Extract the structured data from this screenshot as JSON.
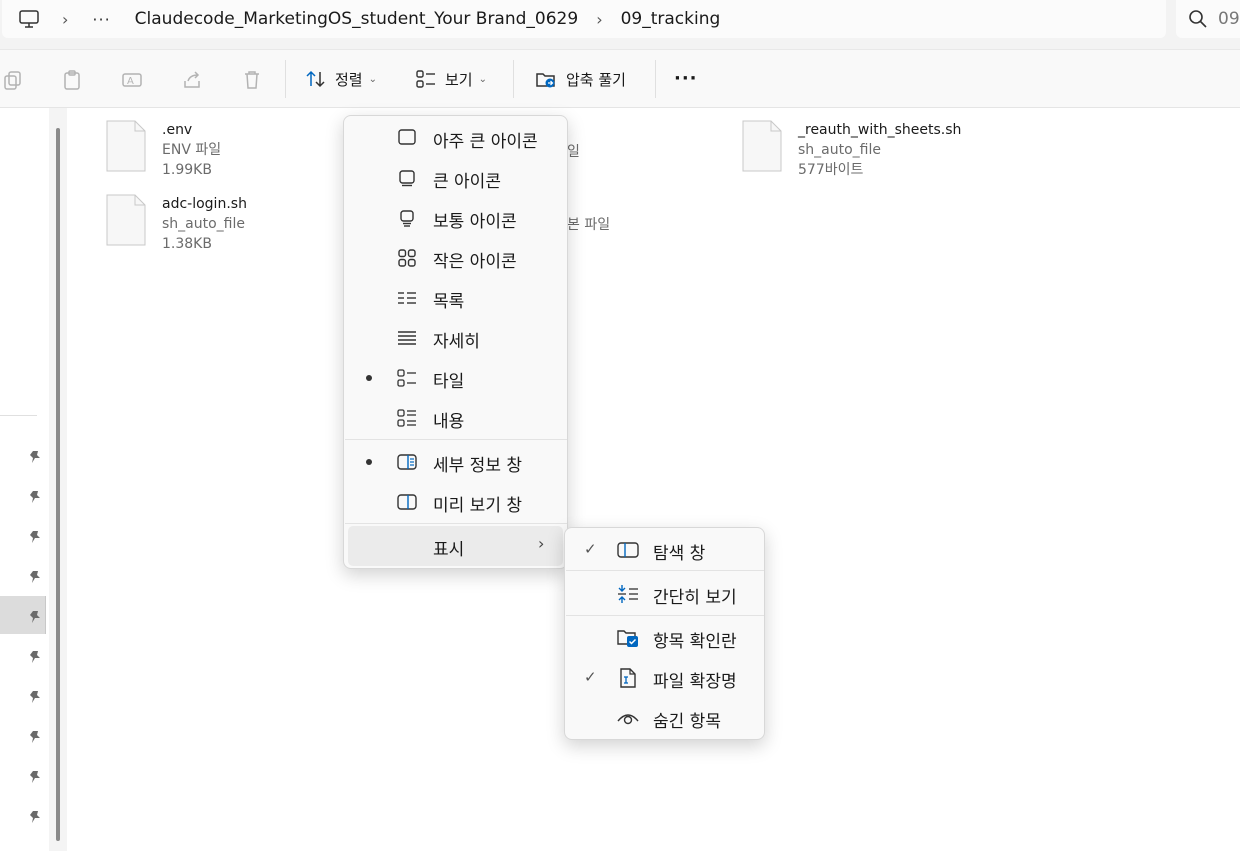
{
  "address_bar": {
    "computer_icon": "monitor-icon",
    "ellipsis": "···",
    "path": [
      "Claudecode_MarketingOS_student_Your Brand_0629",
      "09_tracking"
    ],
    "search_placeholder": "09"
  },
  "toolbar": {
    "sort_label": "정렬",
    "view_label": "보기",
    "extract_label": "압축 풀기",
    "more_label": "···"
  },
  "files": [
    {
      "name": ".env",
      "type": "ENV 파일",
      "size": "1.99KB"
    },
    {
      "name": "adc-login.sh",
      "type": "sh_auto_file",
      "size": "1.38KB"
    },
    {
      "name": "_reauth_with_sheets.sh",
      "type": "sh_auto_file",
      "size": "577바이트"
    }
  ],
  "obscured_text": [
    "일",
    "본 파일"
  ],
  "view_menu": {
    "layout_items": [
      {
        "label": "아주 큰 아이콘",
        "icon": "extra-large-icons-icon",
        "selected": false
      },
      {
        "label": "큰 아이콘",
        "icon": "large-icons-icon",
        "selected": false
      },
      {
        "label": "보통 아이콘",
        "icon": "medium-icons-icon",
        "selected": false
      },
      {
        "label": "작은 아이콘",
        "icon": "small-icons-icon",
        "selected": false
      },
      {
        "label": "목록",
        "icon": "list-icon",
        "selected": false
      },
      {
        "label": "자세히",
        "icon": "details-icon",
        "selected": false
      },
      {
        "label": "타일",
        "icon": "tiles-icon",
        "selected": true
      },
      {
        "label": "내용",
        "icon": "content-icon",
        "selected": false
      }
    ],
    "pane_items": [
      {
        "label": "세부 정보 창",
        "icon": "details-pane-icon",
        "selected": true
      },
      {
        "label": "미리 보기 창",
        "icon": "preview-pane-icon",
        "selected": false
      }
    ],
    "show_item": {
      "label": "표시",
      "arrow": "›"
    }
  },
  "show_submenu": {
    "items": [
      {
        "label": "탐색 창",
        "checked": true,
        "icon": "navigation-pane-icon"
      },
      {
        "label": "간단히 보기",
        "checked": false,
        "icon": "compact-view-icon"
      },
      {
        "label": "항목 확인란",
        "checked": false,
        "icon": "item-checkboxes-icon"
      },
      {
        "label": "파일 확장명",
        "checked": true,
        "icon": "file-extensions-icon"
      },
      {
        "label": "숨긴 항목",
        "checked": false,
        "icon": "hidden-items-icon"
      }
    ],
    "check_glyph": "✓"
  },
  "colors": {
    "accent": "#0067c0",
    "menu_bg": "#f9f9f9",
    "hover_bg": "#ebebeb"
  }
}
